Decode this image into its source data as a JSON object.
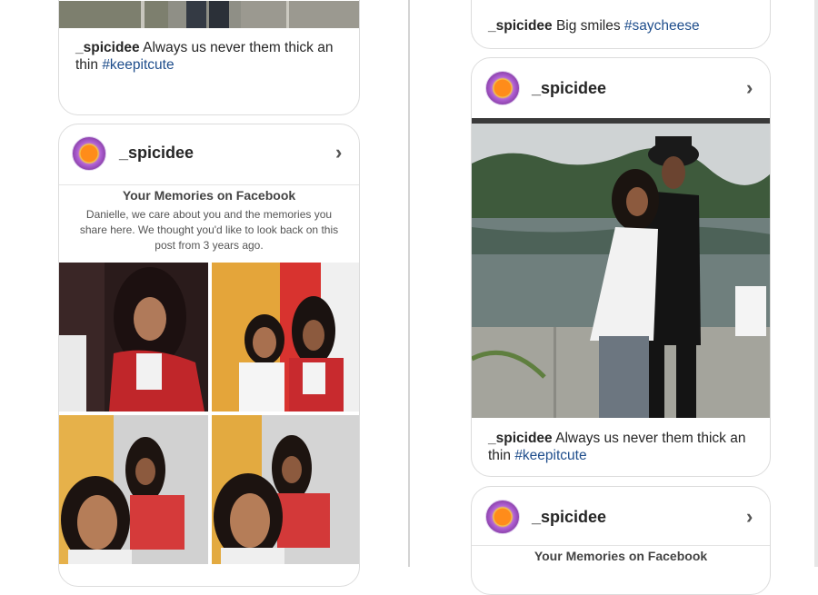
{
  "left": {
    "top_caption": {
      "user": "_spicidee",
      "text": " Always us never them thick an thin ",
      "hashtag": "#keepitcute"
    },
    "memory_post": {
      "username": "_spicidee",
      "memory_title": "Your Memories on Facebook",
      "memory_desc": "Danielle, we care about you and the memories you share here. We thought you'd like to look back on this post from 3 years ago."
    }
  },
  "right": {
    "top_caption": {
      "user": "_spicidee",
      "text": " Big smiles ",
      "hashtag": "#saycheese"
    },
    "post": {
      "username": "_spicidee",
      "caption_user": "_spicidee",
      "caption_text": " Always us never them thick an thin ",
      "caption_hashtag": "#keepitcute"
    },
    "memory_post": {
      "username": "_spicidee",
      "memory_title": "Your Memories on Facebook"
    }
  },
  "icons": {
    "chevron": "chevron-right-icon"
  },
  "colors": {
    "hashtag": "#1f4e8c",
    "card_border": "#dcdcdc"
  }
}
